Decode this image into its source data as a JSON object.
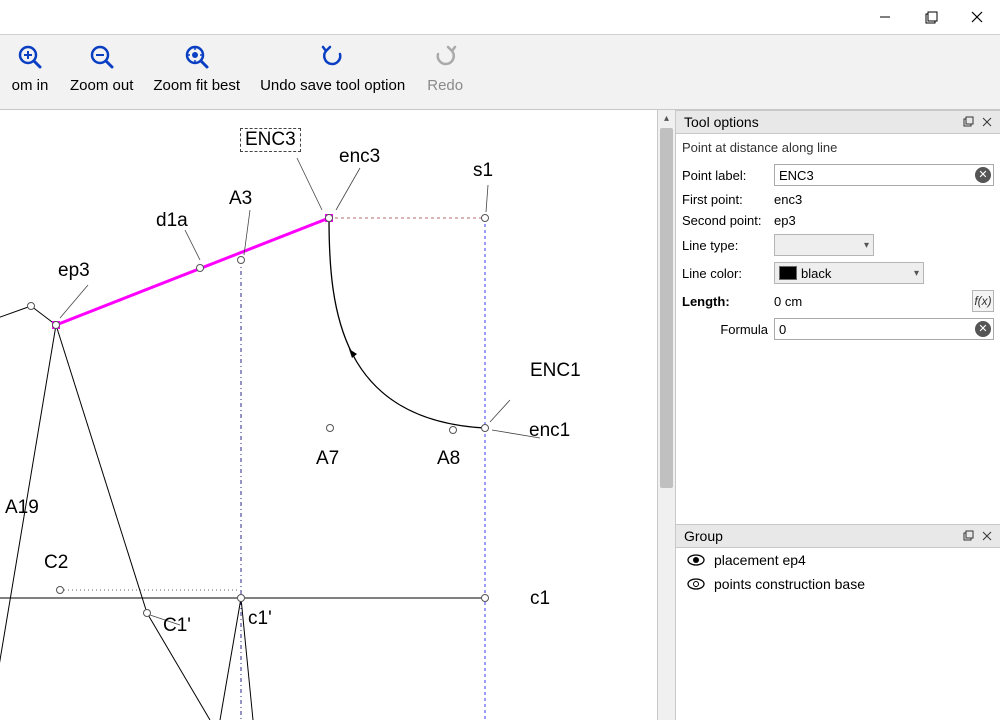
{
  "titlebar": {
    "minimize": "—",
    "maximize": "❐",
    "close": "✕"
  },
  "toolbar": {
    "zoom_in": "om in",
    "zoom_out": "Zoom out",
    "zoom_fit": "Zoom fit best",
    "undo": "Undo save tool option",
    "redo": "Redo"
  },
  "canvas": {
    "labels": {
      "ENC3": "ENC3",
      "enc3": "enc3",
      "s1": "s1",
      "A3": "A3",
      "d1a": "d1a",
      "ep3": "ep3",
      "ENC1": "ENC1",
      "enc1": "enc1",
      "A7": "A7",
      "A8": "A8",
      "A19": "A19",
      "C2": "C2",
      "C1p": "C1'",
      "c1p": "c1'",
      "c1": "c1"
    }
  },
  "panel": {
    "title": "Tool options",
    "group_title": "Group",
    "tool_name": "Point at distance along line",
    "point_label_label": "Point label:",
    "point_label_value": "ENC3",
    "first_point_label": "First point:",
    "first_point_value": "enc3",
    "second_point_label": "Second point:",
    "second_point_value": "ep3",
    "line_type_label": "Line type:",
    "line_color_label": "Line color:",
    "line_color_value": "black",
    "length_label": "Length:",
    "length_value": "0 cm",
    "formula_label": "Formula",
    "formula_value": "0",
    "fx": "f(x)"
  },
  "groups": {
    "item1": "placement ep4",
    "item2": "points construction base"
  }
}
